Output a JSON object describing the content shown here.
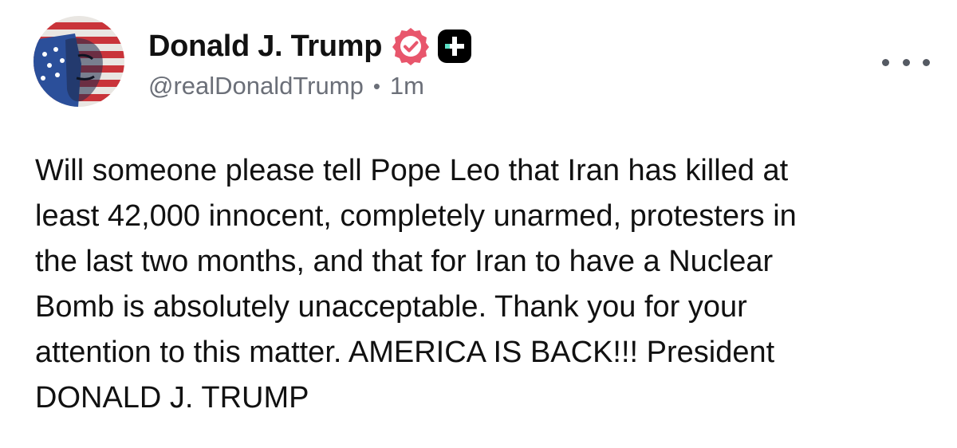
{
  "author": {
    "display_name": "Donald J. Trump",
    "handle": "@realDonaldTrump",
    "separator": "•",
    "timestamp": "1m",
    "avatar_icon": "flag-portrait-avatar",
    "verified_icon": "verified-badge-icon",
    "verified_color": "#e8566c",
    "plus_badge_icon": "plus-badge-icon",
    "plus_badge_color": "#000000",
    "plus_badge_accent": "#5ce0c6"
  },
  "menu": {
    "icon": "more-options-icon"
  },
  "post": {
    "lines": [
      "Will someone please tell Pope Leo that Iran has killed at",
      "least 42,000 innocent, completely unarmed, protesters in",
      "the last two months, and that for Iran to have a Nuclear",
      "Bomb is absolutely unacceptable. Thank you for your",
      "attention to this matter. AMERICA IS BACK!!! President",
      "DONALD J. TRUMP"
    ]
  }
}
